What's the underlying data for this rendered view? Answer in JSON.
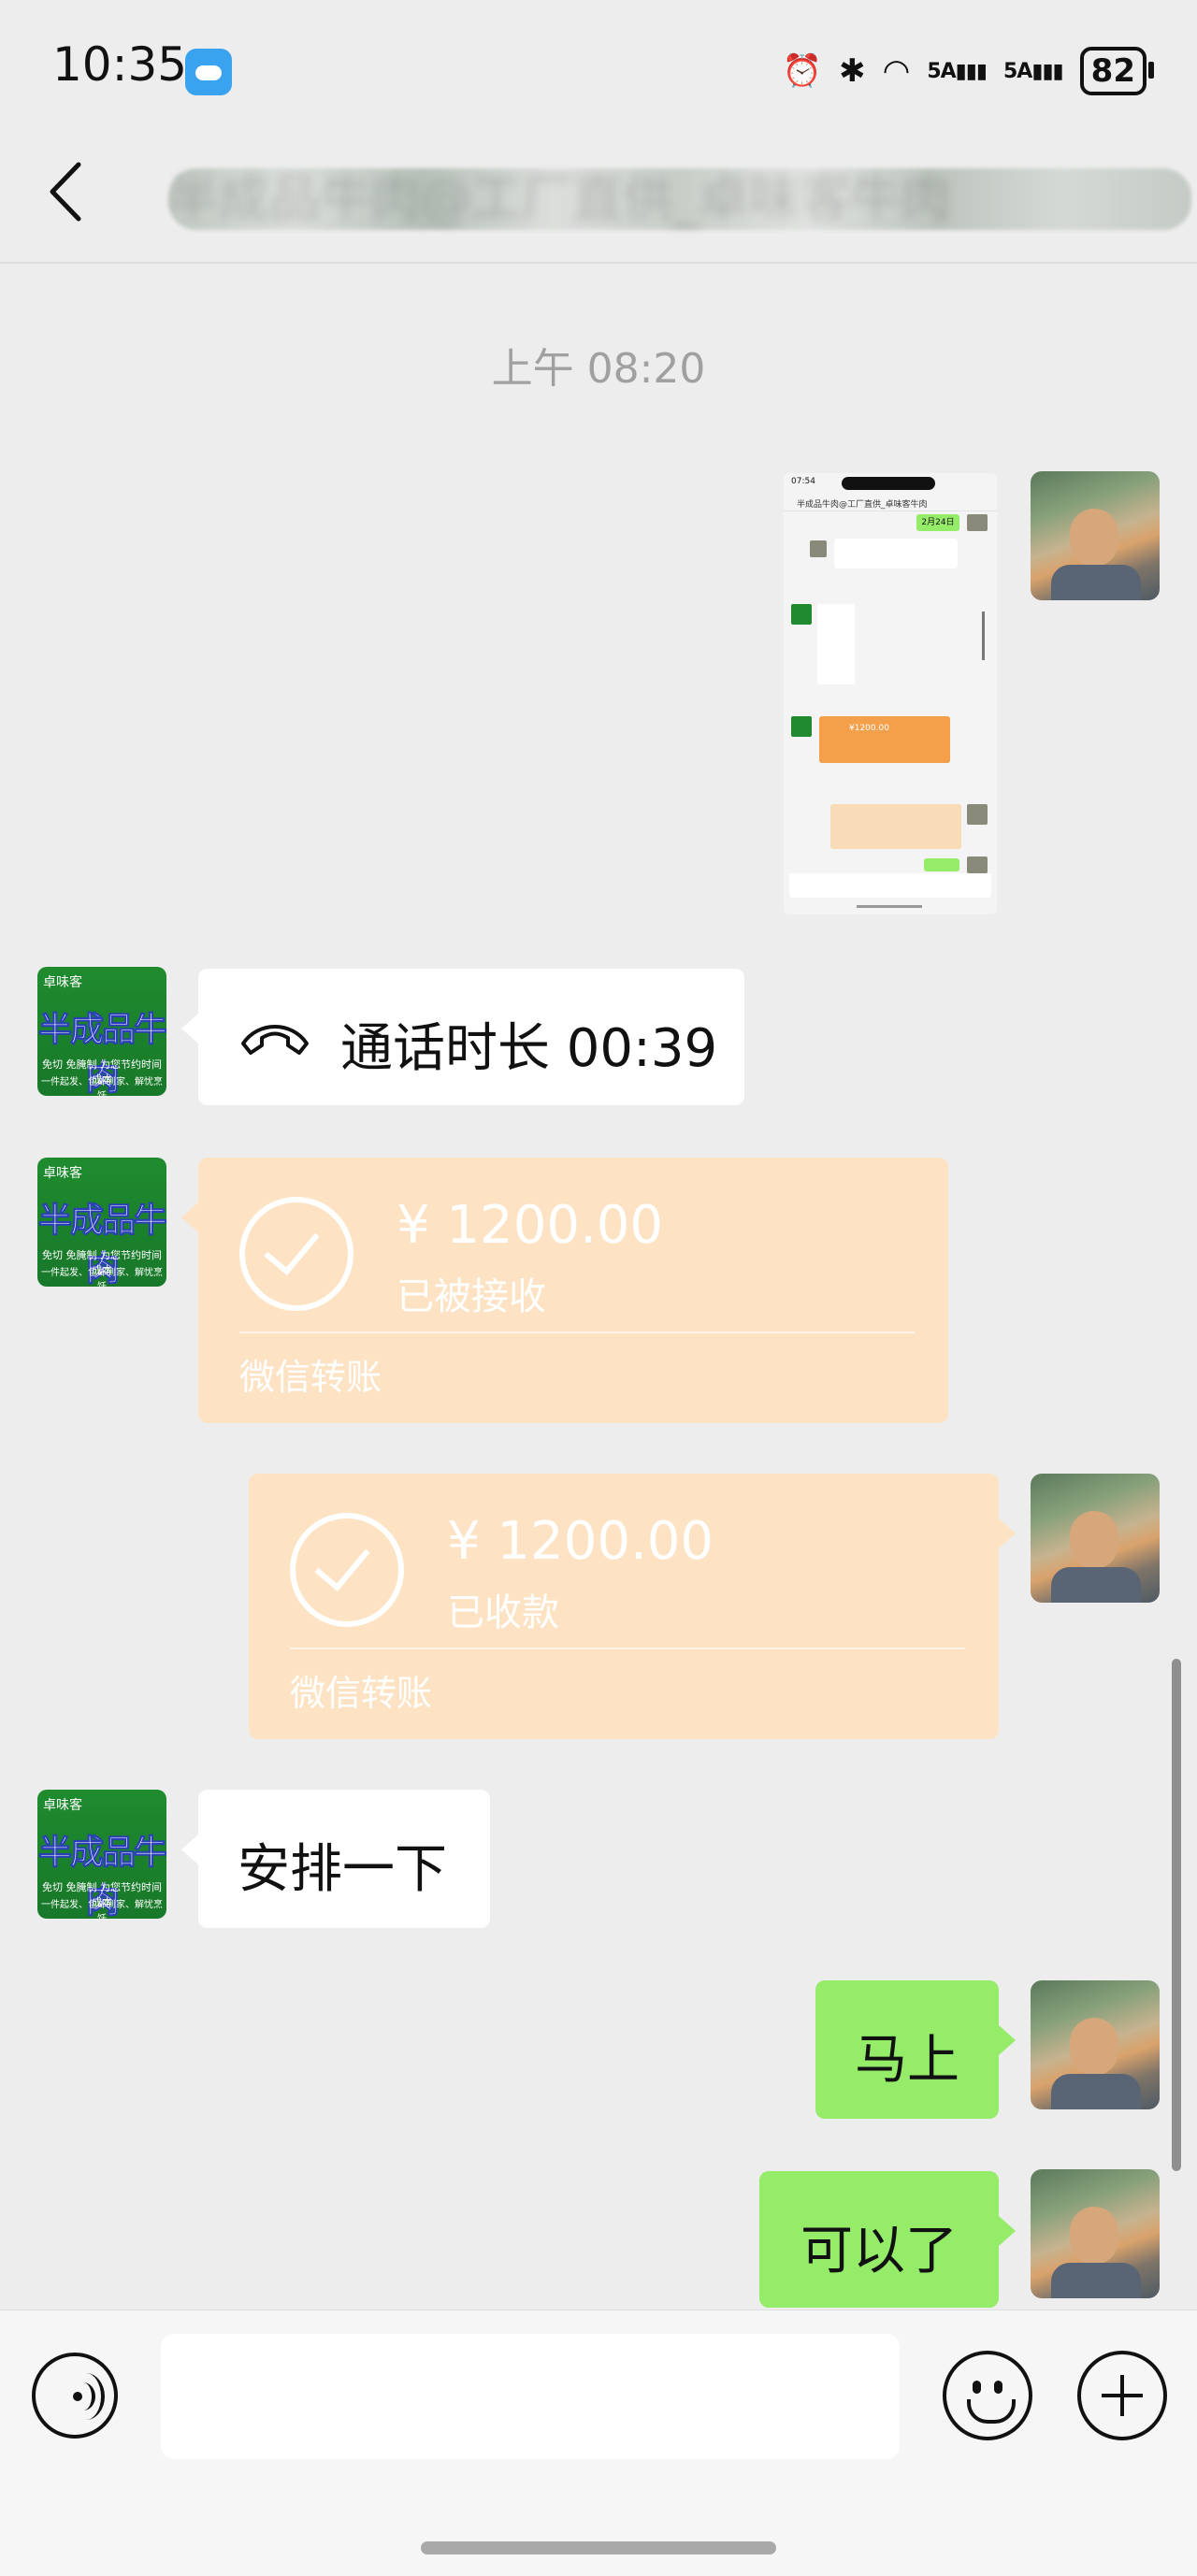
{
  "status_bar": {
    "time": "10:35",
    "signal_1": "5A",
    "signal_2": "5A",
    "battery": "82"
  },
  "header": {
    "title": "半成品牛肉@工厂直供_卓味客牛肉"
  },
  "thumbnail": {
    "time": "07:54",
    "title": "半成品牛肉@工厂直供_卓味客牛肉",
    "date_badge": "2月24日",
    "amount": "¥1200.00"
  },
  "chat": {
    "timestamp": "上午 08:20",
    "call": {
      "label": "通话时长 00:39"
    },
    "transfer_received_by_them": {
      "amount": "¥ 1200.00",
      "status": "已被接收",
      "kind": "微信转账"
    },
    "transfer_received_by_me": {
      "amount": "¥ 1200.00",
      "status": "已收款",
      "kind": "微信转账"
    },
    "msg_arrange": "安排一下",
    "msg_right_away": "马上",
    "msg_done": "可以了"
  },
  "shop_avatar": {
    "brand": "卓味客",
    "name": "半成品牛肉",
    "line1": "免切 免腌制 为您节约时间成本",
    "line2": "一件起发、包邮到家、解忧烹饪"
  },
  "colors": {
    "background": "#ededed",
    "green_bubble": "#95ec69",
    "transfer_bubble": "#fde3c4"
  },
  "icons": [
    "back-arrow-icon",
    "phone-hangup-icon",
    "check-circle-icon",
    "voice-icon",
    "emoji-icon",
    "plus-icon"
  ]
}
